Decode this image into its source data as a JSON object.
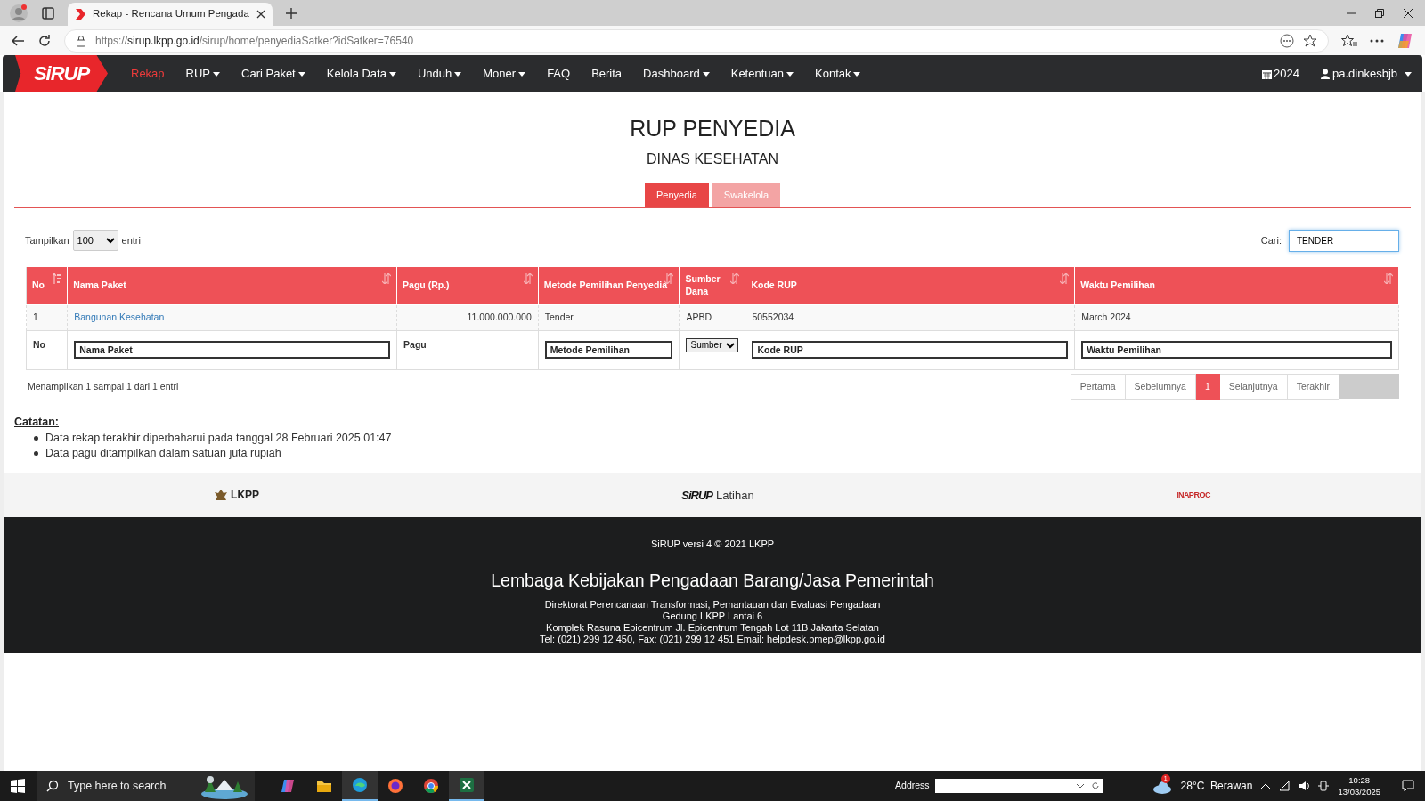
{
  "browser": {
    "tabs": [
      {
        "title": "Rekap - Rencana Umum Pengada",
        "selected": true
      }
    ],
    "url": {
      "scheme": "https://",
      "host": "sirup.lkpp.go.id",
      "path": "/sirup/home/penyediaSatker?idSatker=76540"
    }
  },
  "navbar": {
    "logo": "SiRUP",
    "items": [
      {
        "label": "Rekap",
        "dropdown": false,
        "selected": true
      },
      {
        "label": "RUP",
        "dropdown": true,
        "selected": false
      },
      {
        "label": "Cari Paket",
        "dropdown": true,
        "selected": false
      },
      {
        "label": "Kelola Data",
        "dropdown": true,
        "selected": false
      },
      {
        "label": "Unduh",
        "dropdown": true,
        "selected": false
      },
      {
        "label": "Moner",
        "dropdown": true,
        "selected": false
      },
      {
        "label": "FAQ",
        "dropdown": false,
        "selected": false
      },
      {
        "label": "Berita",
        "dropdown": false,
        "selected": false
      },
      {
        "label": "Dashboard",
        "dropdown": true,
        "selected": false
      },
      {
        "label": "Ketentuan",
        "dropdown": true,
        "selected": false
      },
      {
        "label": "Kontak",
        "dropdown": true,
        "selected": false
      }
    ],
    "year": "2024",
    "user": "pa.dinkesbjb"
  },
  "page": {
    "title": "RUP PENYEDIA",
    "subtitle": "DINAS KESEHATAN",
    "segments": [
      {
        "label": "Penyedia",
        "selected": true
      },
      {
        "label": "Swakelola",
        "selected": false
      }
    ],
    "length": {
      "label": "Tampilkan",
      "value": "100",
      "suffix": "entri"
    },
    "search": {
      "label": "Cari:",
      "value": "TENDER"
    },
    "table": {
      "columns": [
        {
          "label": "No",
          "sorted": true
        },
        {
          "label": "Nama Paket",
          "sorted": false
        },
        {
          "label": "Pagu (Rp.)",
          "sorted": false
        },
        {
          "label": "Metode Pemilihan Penyedia",
          "sorted": false
        },
        {
          "label": "Sumber Dana",
          "sorted": false
        },
        {
          "label": "Kode RUP",
          "sorted": false
        },
        {
          "label": "Waktu Pemilihan",
          "sorted": false
        }
      ],
      "rows": [
        {
          "no": "1",
          "nama_paket": "Bangunan Kesehatan",
          "pagu": "11.000.000.000",
          "metode": "Tender",
          "sumber_dana": "APBD",
          "kode_rup": "50552034",
          "waktu": "March 2024"
        }
      ],
      "filters": [
        {
          "kind": "label",
          "text": "No"
        },
        {
          "kind": "input",
          "placeholder": "Nama Paket"
        },
        {
          "kind": "label",
          "text": "Pagu"
        },
        {
          "kind": "input",
          "placeholder": "Metode Pemilihan"
        },
        {
          "kind": "select",
          "value": "Sumber"
        },
        {
          "kind": "input",
          "placeholder": "Kode RUP"
        },
        {
          "kind": "input",
          "placeholder": "Waktu Pemilihan"
        }
      ]
    },
    "info": "Menampilkan 1 sampai 1 dari 1 entri",
    "pagination": [
      {
        "label": "Pertama",
        "selected": false
      },
      {
        "label": "Sebelumnya",
        "selected": false
      },
      {
        "label": "1",
        "selected": true
      },
      {
        "label": "Selanjutnya",
        "selected": false
      },
      {
        "label": "Terakhir",
        "selected": false
      }
    ],
    "notes": {
      "heading": "Catatan:",
      "items": [
        "Data rekap terakhir diperbaharui pada tanggal 28 Februari 2025 01:47",
        "Data pagu ditampilkan dalam satuan juta rupiah"
      ]
    }
  },
  "logos": {
    "lkpp": "LKPP",
    "sirup": "SiRUP",
    "sirup_suffix": "Latihan",
    "inaproc": "INAPROC"
  },
  "footer": {
    "version": "SiRUP versi 4 © 2021 LKPP",
    "org": "Lembaga Kebijakan Pengadaan Barang/Jasa Pemerintah",
    "lines": [
      "Direktorat Perencanaan Transformasi, Pemantauan dan Evaluasi Pengadaan",
      "Gedung LKPP Lantai 6",
      "Komplek Rasuna Epicentrum Jl. Epicentrum Tengah Lot 11B Jakarta Selatan",
      "Tel: (021) 299 12 450, Fax: (021) 299 12 451 Email: helpdesk.pmep@lkpp.go.id"
    ]
  },
  "taskbar": {
    "search_placeholder": "Type here to search",
    "address_label": "Address",
    "weather_badge": "1",
    "weather": "28°C  Berawan",
    "time": "10:28",
    "date": "13/03/2025"
  }
}
